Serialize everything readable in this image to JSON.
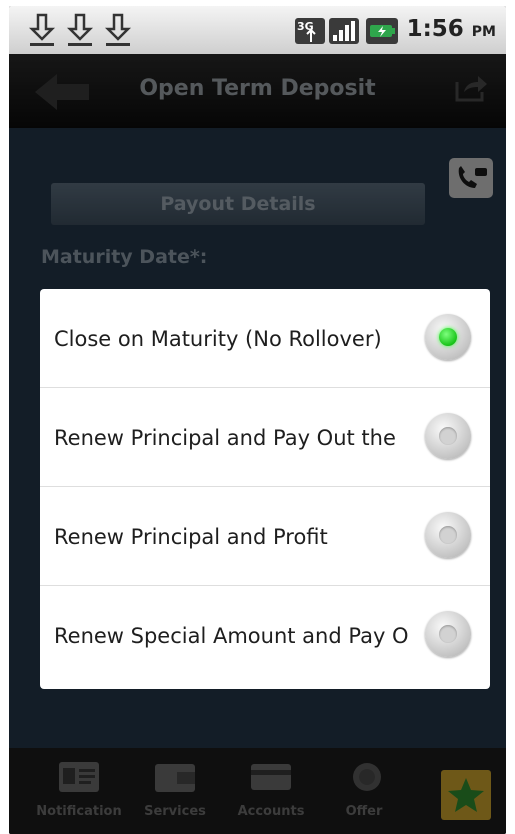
{
  "status_bar": {
    "time": "1:56",
    "ampm": "PM",
    "network": "3G"
  },
  "action_bar": {
    "title": "Open Term Deposit"
  },
  "form": {
    "tab_label": "Payout Details",
    "maturity_label": "Maturity Date*:"
  },
  "dialog": {
    "options": [
      {
        "label": "Close on Maturity (No Rollover)",
        "selected": true
      },
      {
        "label": "Renew Principal and Pay Out the",
        "selected": false
      },
      {
        "label": "Renew Principal and Profit",
        "selected": false
      },
      {
        "label": "Renew Special Amount and Pay O",
        "selected": false
      }
    ]
  },
  "bottom_nav": {
    "items": [
      {
        "label": "Notification",
        "icon": "id-card-icon"
      },
      {
        "label": "Services",
        "icon": "wallet-icon"
      },
      {
        "label": "Accounts",
        "icon": "card-icon"
      },
      {
        "label": "Offer",
        "icon": "badge-icon"
      }
    ]
  },
  "colors": {
    "content_bg": "#233648",
    "radio_selected": "#18c418",
    "fav_button": "#c9a12c"
  }
}
